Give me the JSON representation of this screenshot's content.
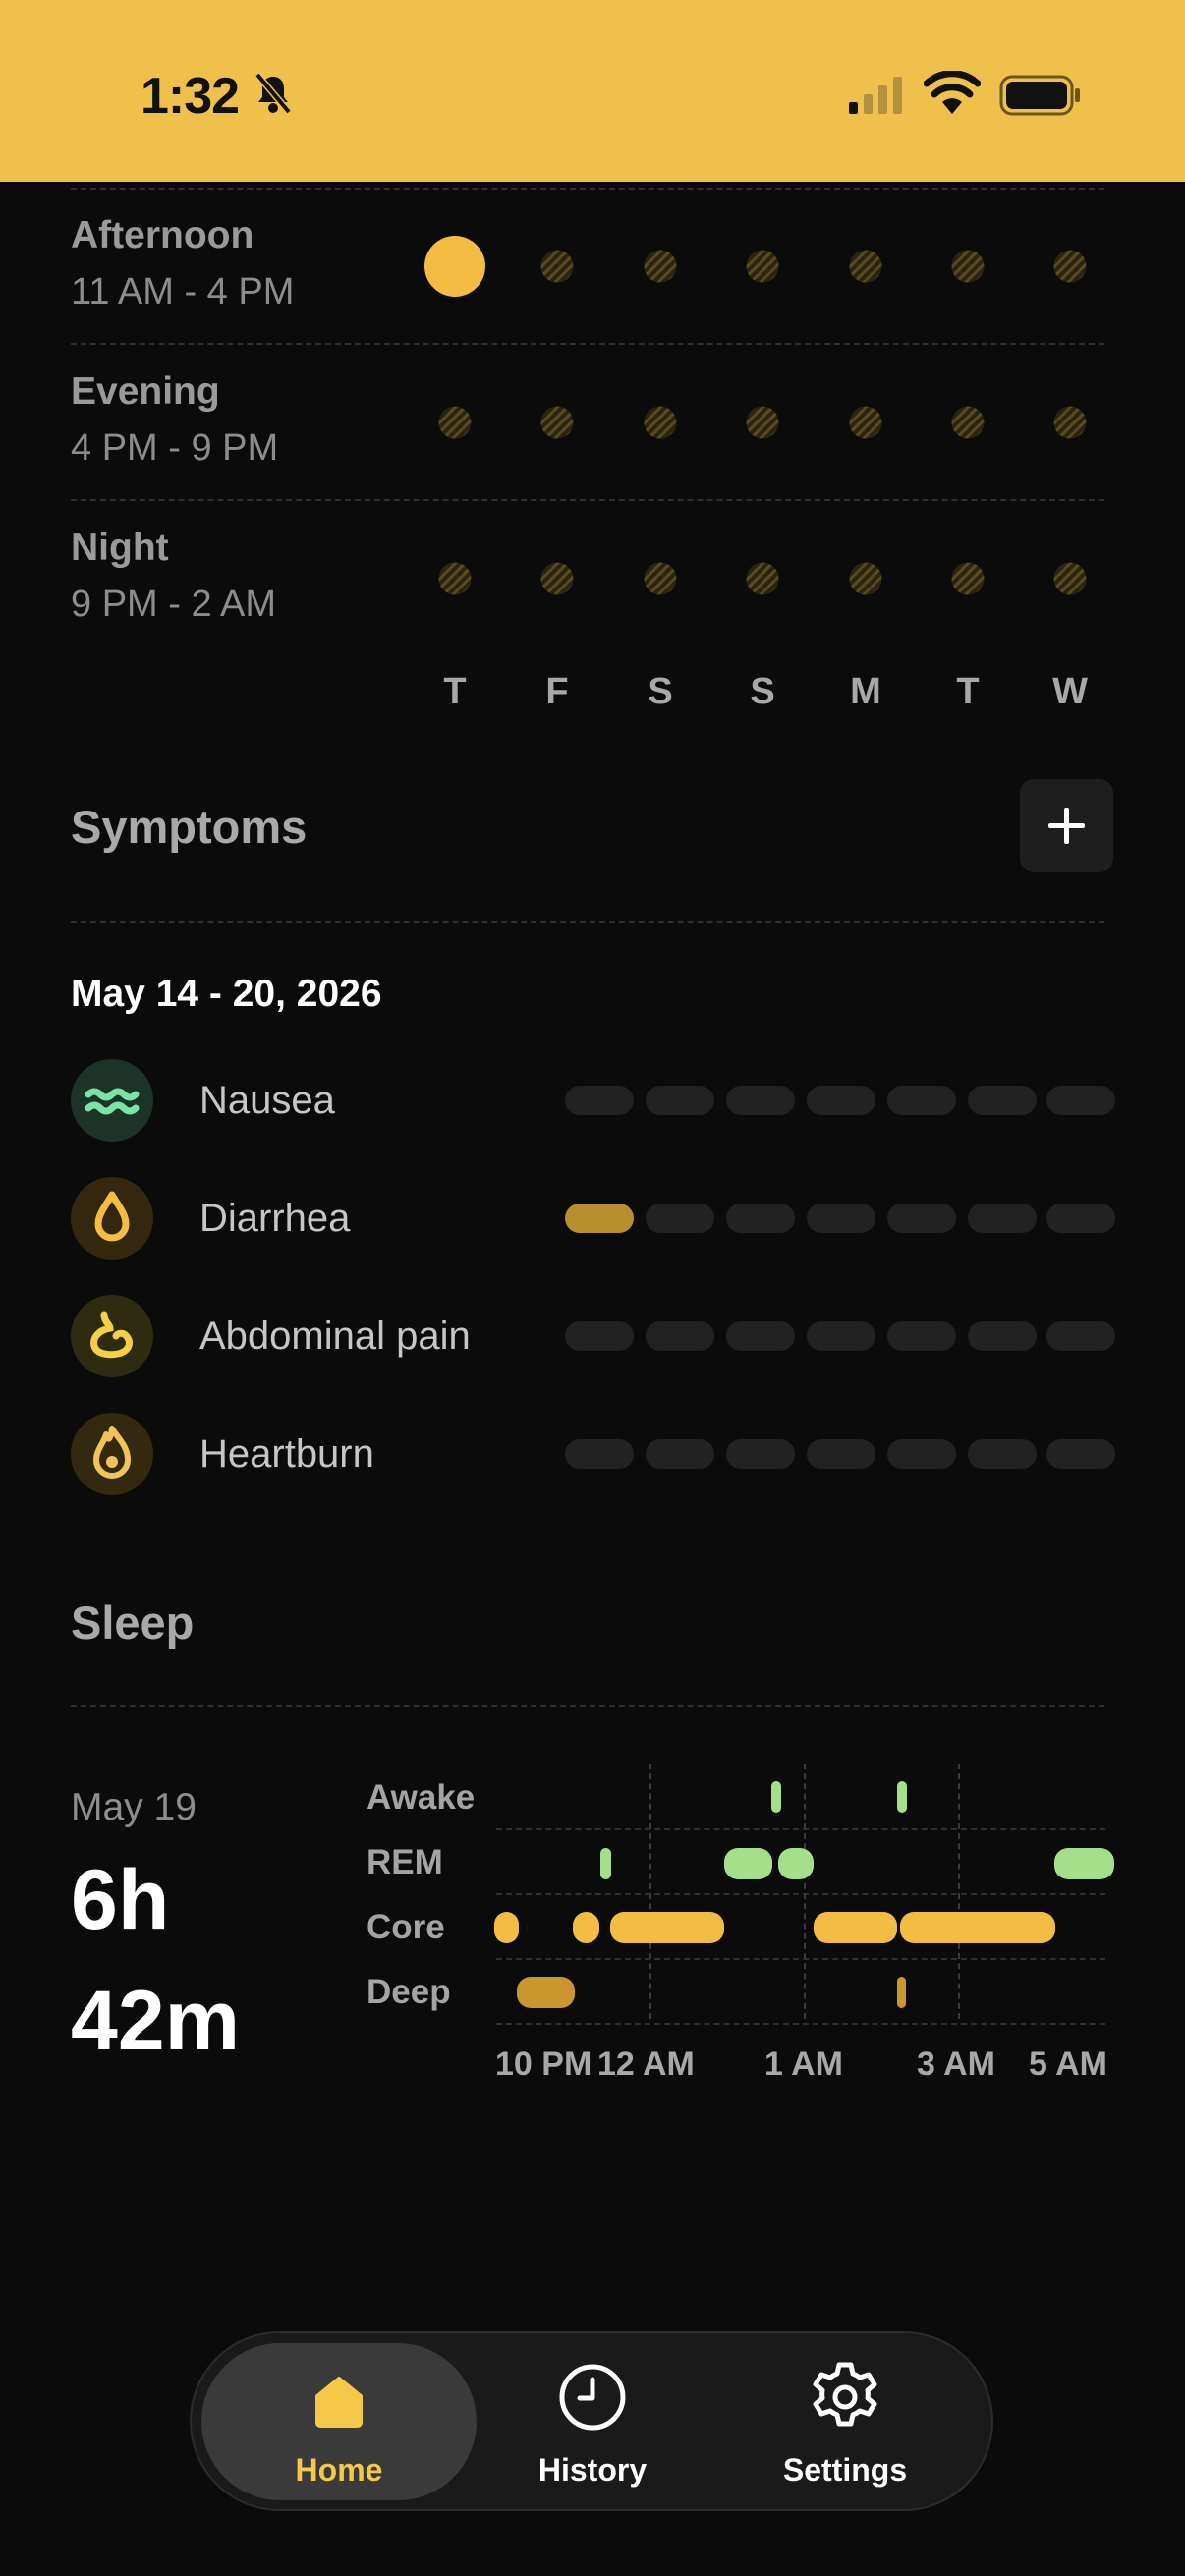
{
  "status": {
    "time": "1:32"
  },
  "schedule": {
    "slots": [
      {
        "title": "Afternoon",
        "range": "11 AM - 4 PM"
      },
      {
        "title": "Evening",
        "range": "4 PM - 9 PM"
      },
      {
        "title": "Night",
        "range": "9 PM - 2 AM"
      }
    ],
    "days": [
      "T",
      "F",
      "S",
      "S",
      "M",
      "T",
      "W"
    ]
  },
  "symptoms": {
    "title": "Symptoms",
    "week_range": "May 14 - 20, 2026",
    "items": [
      {
        "name": "Nausea",
        "icon": "waves-icon",
        "color": "#7be3a8",
        "logged_days": []
      },
      {
        "name": "Diarrhea",
        "icon": "drop-icon",
        "color": "#f3bd44",
        "logged_days": [
          0
        ]
      },
      {
        "name": "Abdominal pain",
        "icon": "stomach-icon",
        "color": "#f3d046",
        "logged_days": []
      },
      {
        "name": "Heartburn",
        "icon": "flame-icon",
        "color": "#f3c35a",
        "logged_days": []
      }
    ]
  },
  "sleep": {
    "title": "Sleep",
    "date": "May 19",
    "hours": "6h",
    "minutes": "42m",
    "stages": [
      "Awake",
      "REM",
      "Core",
      "Deep"
    ],
    "x_labels": [
      "10 PM",
      "12 AM",
      "1 AM",
      "3 AM",
      "5 AM"
    ],
    "stage_colors": {
      "Awake": "#a6df8a",
      "REM": "#a6df8a",
      "Core": "#f3bd44",
      "Deep": "#c9972e"
    }
  },
  "tabs": [
    {
      "label": "Home",
      "icon": "home-icon",
      "active": true
    },
    {
      "label": "History",
      "icon": "clock-icon",
      "active": false
    },
    {
      "label": "Settings",
      "icon": "gear-icon",
      "active": false
    }
  ],
  "colors": {
    "accent": "#f0c04c",
    "background": "#0b0b0b"
  }
}
